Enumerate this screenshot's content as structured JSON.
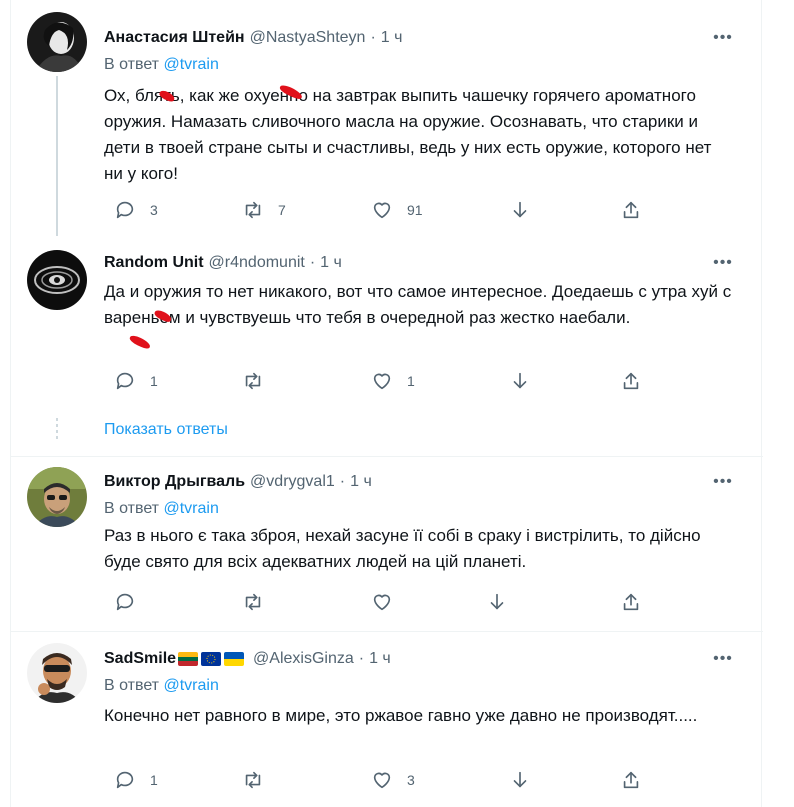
{
  "tweets": [
    {
      "name": "Анастасия Штейн",
      "handle": "@NastyaShteyn",
      "dot": "·",
      "time": "1 ч",
      "more": "•••",
      "reply_prefix": "В ответ",
      "reply_handle": "@tvrain",
      "text": "Ох, блять, как же охуенно на завтрак выпить чашечку горячего ароматного оружия. Намазать сливочного масла на оружие. Осознавать, что старики и дети в твоей стране сыты и счастливы, ведь у них есть оружие, которого нет ни у кого!",
      "replies": "3",
      "retweets": "7",
      "likes": "91"
    },
    {
      "name": "Random Unit",
      "handle": "@r4ndomunit",
      "dot": "·",
      "time": "1 ч",
      "more": "•••",
      "text": "Да и оружия то нет никакого, вот что самое интересное. Доедаешь с утра хуй с вареньем и чувствуешь что тебя в очередной раз жестко наебали.",
      "replies": "1",
      "retweets": "",
      "likes": "1"
    },
    {
      "name": "Виктор Дрыгваль",
      "handle": "@vdrygval1",
      "dot": "·",
      "time": "1 ч",
      "more": "•••",
      "reply_prefix": "В ответ",
      "reply_handle": "@tvrain",
      "text": "Раз в нього є така зброя, нехай засуне її собі в сраку і вистрілить, то дійсно буде свято для всіх адекватних людей на цій планеті.",
      "replies": "",
      "retweets": "",
      "likes": ""
    },
    {
      "name": "SadSmile",
      "handle": "@AlexisGinza",
      "dot": "·",
      "time": "1 ч",
      "more": "•••",
      "reply_prefix": "В ответ",
      "reply_handle": "@tvrain",
      "text": "Конечно нет равного в мире, это ржавое гавно уже давно не производят.....",
      "replies": "1",
      "retweets": "",
      "likes": "3"
    }
  ],
  "show_replies": "Показать ответы",
  "colors": {
    "link": "#1d9bf0",
    "muted": "#536471",
    "text": "#0f1419",
    "redaction": "#e0111b"
  }
}
